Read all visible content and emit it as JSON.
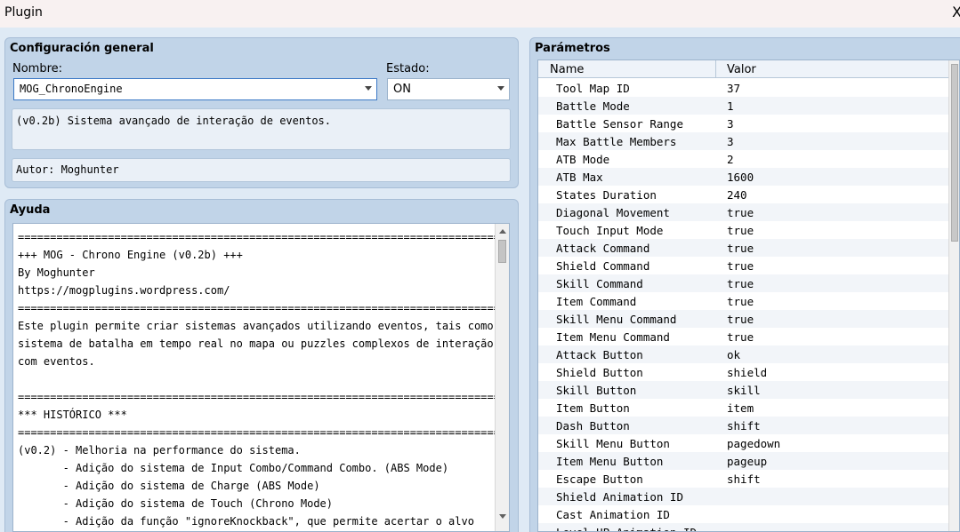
{
  "window": {
    "title": "Plugin",
    "close_glyph": "X"
  },
  "general": {
    "title": "Configuración general",
    "name_label": "Nombre:",
    "name_value": "MOG_ChronoEngine",
    "state_label": "Estado:",
    "state_value": "ON",
    "description": "(v0.2b) Sistema avançado de interação de eventos.",
    "author": "Autor: Moghunter"
  },
  "help": {
    "title": "Ayuda",
    "lines": [
      "==============================================================================",
      "+++ MOG - Chrono Engine (v0.2b) +++",
      "By Moghunter",
      "https://mogplugins.wordpress.com/",
      "==============================================================================",
      "Este plugin permite criar sistemas avançados utilizando eventos, tais como",
      "sistema de batalha em tempo real no mapa ou puzzles complexos de interação",
      "com eventos.",
      "",
      "==============================================================================",
      "*** HISTÓRICO ***",
      "==============================================================================",
      "(v0.2) - Melhoria na performance do sistema.",
      "       - Adição do sistema de Input Combo/Command Combo. (ABS Mode)",
      "       - Adição do sistema de Charge (ABS Mode)",
      "       - Adição do sistema de Touch (Chrono Mode)",
      "       - Adição da função \"ignoreKnockback\", que permite acertar o alvo"
    ]
  },
  "params": {
    "title": "Parámetros",
    "col_name": "Name",
    "col_value": "Valor",
    "rows": [
      {
        "name": "Tool Map ID",
        "value": "37"
      },
      {
        "name": "Battle Mode",
        "value": "1"
      },
      {
        "name": "Battle Sensor Range",
        "value": "3"
      },
      {
        "name": "Max Battle Members",
        "value": "3"
      },
      {
        "name": "ATB Mode",
        "value": "2"
      },
      {
        "name": "ATB Max",
        "value": "1600"
      },
      {
        "name": "States Duration",
        "value": "240"
      },
      {
        "name": "Diagonal Movement",
        "value": "true"
      },
      {
        "name": "Touch Input Mode",
        "value": "true"
      },
      {
        "name": "Attack Command",
        "value": "true"
      },
      {
        "name": "Shield Command",
        "value": "true"
      },
      {
        "name": "Skill Command",
        "value": "true"
      },
      {
        "name": "Item Command",
        "value": "true"
      },
      {
        "name": "Skill Menu Command",
        "value": "true"
      },
      {
        "name": "Item Menu Command",
        "value": "true"
      },
      {
        "name": "Attack Button",
        "value": "ok"
      },
      {
        "name": "Shield Button",
        "value": "shield"
      },
      {
        "name": "Skill Button",
        "value": "skill"
      },
      {
        "name": "Item Button",
        "value": "item"
      },
      {
        "name": "Dash Button",
        "value": "shift"
      },
      {
        "name": "Skill Menu Button",
        "value": "pagedown"
      },
      {
        "name": "Item Menu Button",
        "value": "pageup"
      },
      {
        "name": "Escape Button",
        "value": "shift"
      },
      {
        "name": "Shield Animation ID",
        "value": ""
      },
      {
        "name": "Cast Animation ID",
        "value": ""
      },
      {
        "name": "Level UP Animation ID",
        "value": ""
      }
    ]
  }
}
